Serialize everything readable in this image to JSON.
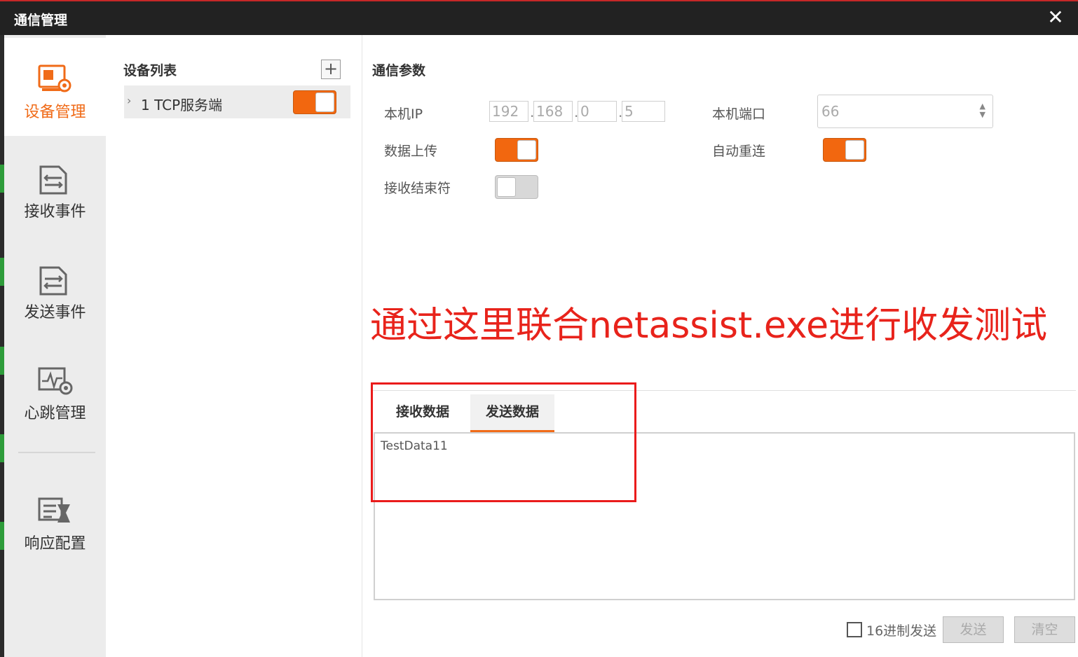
{
  "window": {
    "title": "通信管理",
    "close_icon": "close-icon"
  },
  "nav": {
    "items": [
      {
        "label": "设备管理",
        "icon": "device-manage-icon",
        "active": true
      },
      {
        "label": "接收事件",
        "icon": "receive-event-icon",
        "active": false
      },
      {
        "label": "发送事件",
        "icon": "send-event-icon",
        "active": false
      },
      {
        "label": "心跳管理",
        "icon": "heartbeat-icon",
        "active": false
      },
      {
        "label": "响应配置",
        "icon": "response-config-icon",
        "active": false
      }
    ]
  },
  "devices": {
    "title": "设备列表",
    "add_icon": "plus-icon",
    "items": [
      {
        "label": "1 TCP服务端",
        "enabled": true
      }
    ]
  },
  "params": {
    "title": "通信参数",
    "local_ip_label": "本机IP",
    "ip": [
      "192",
      "168",
      "0",
      "5"
    ],
    "local_port_label": "本机端口",
    "port": "66",
    "data_upload_label": "数据上传",
    "data_upload_on": true,
    "auto_reconnect_label": "自动重连",
    "auto_reconnect_on": true,
    "recv_terminator_label": "接收结束符",
    "recv_terminator_on": false
  },
  "annotation": "通过这里联合netassist.exe进行收发测试",
  "data_tabs": {
    "tabs": [
      {
        "label": "接收数据",
        "active": false
      },
      {
        "label": "发送数据",
        "active": true
      }
    ],
    "content": "TestData11"
  },
  "footer": {
    "hex_send_label": "16进制发送",
    "hex_send_checked": false,
    "send_button": "发送",
    "clear_button": "清空"
  },
  "colors": {
    "accent": "#f06b18",
    "annotation": "#e8231b",
    "titlebar": "#222222"
  }
}
